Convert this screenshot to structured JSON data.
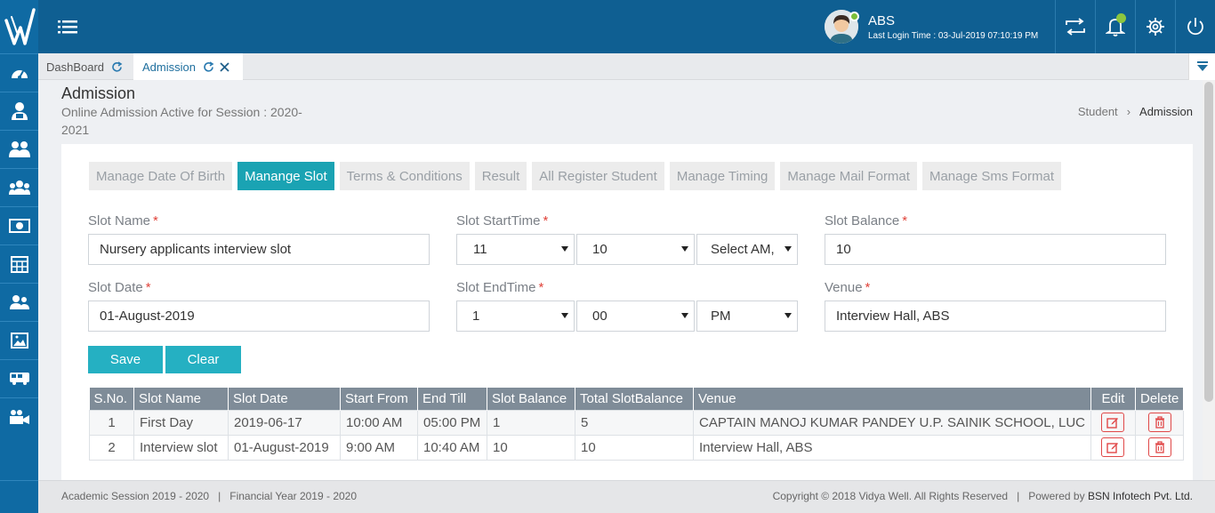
{
  "colors": {
    "primary": "#0f6aa3",
    "accent": "#1aa3b3",
    "required": "#e0433a",
    "table_header": "#7f8c98"
  },
  "header": {
    "user_name": "ABS",
    "last_login": "Last Login Time : 03-Jul-2019 07:10:19 PM",
    "icons": [
      "menu-icon",
      "transfer-icon",
      "bell-icon",
      "gear-icon",
      "power-icon"
    ]
  },
  "sidebar": {
    "icons": [
      "dashboard-icon",
      "student-icon",
      "staff-icon",
      "users-icon",
      "fees-icon",
      "calendar-icon",
      "parents-icon",
      "gallery-icon",
      "transport-icon",
      "video-icon"
    ]
  },
  "tabs": [
    {
      "label": "DashBoard"
    },
    {
      "label": "Admission"
    }
  ],
  "page": {
    "title": "Admission",
    "subtitle": "Online Admission Active for Session : 2020-2021",
    "breadcrumb": {
      "parent": "Student",
      "separator": "›",
      "current": "Admission"
    }
  },
  "subtabs": [
    {
      "label": "Manage Date Of Birth"
    },
    {
      "label": "Manange Slot"
    },
    {
      "label": "Terms & Conditions"
    },
    {
      "label": "Result"
    },
    {
      "label": "All Register Student"
    },
    {
      "label": "Manage Timing"
    },
    {
      "label": "Manage Mail Format"
    },
    {
      "label": "Manage Sms Format"
    }
  ],
  "form": {
    "required_mark": "*",
    "slot_name": {
      "label": "Slot Name",
      "value": "Nursery applicants interview slot"
    },
    "slot_start": {
      "label": "Slot StartTime",
      "hour": "11",
      "minute": "10",
      "ampm": "Select AM,"
    },
    "slot_balance": {
      "label": "Slot Balance",
      "value": "10"
    },
    "slot_date": {
      "label": "Slot Date",
      "value": "01-August-2019"
    },
    "slot_end": {
      "label": "Slot EndTime",
      "hour": "1",
      "minute": "00",
      "ampm": "PM"
    },
    "venue": {
      "label": "Venue",
      "value": "Interview Hall, ABS"
    },
    "save_label": "Save",
    "clear_label": "Clear"
  },
  "table": {
    "headers": [
      "S.No.",
      "Slot Name",
      "Slot Date",
      "Start From",
      "End Till",
      "Slot Balance",
      "Total SlotBalance",
      "Venue",
      "Edit",
      "Delete"
    ],
    "rows": [
      {
        "sno": "1",
        "name": "First Day",
        "date": "2019-06-17",
        "start": "10:00 AM",
        "end": "05:00 PM",
        "balance": "1",
        "total": "5",
        "venue": "CAPTAIN MANOJ KUMAR PANDEY U.P. SAINIK SCHOOL, LUC"
      },
      {
        "sno": "2",
        "name": "Interview slot",
        "date": "01-August-2019",
        "start": "9:00 AM",
        "end": "10:40 AM",
        "balance": "10",
        "total": "10",
        "venue": "Interview Hall, ABS"
      }
    ]
  },
  "footer": {
    "academic": "Academic Session 2019 - 2020",
    "financial": "Financial Year 2019 - 2020",
    "copyright": "Copyright © 2018 Vidya Well. All Rights Reserved",
    "powered_prefix": "Powered by",
    "powered_company": "BSN Infotech Pvt. Ltd.",
    "separator": "|"
  }
}
